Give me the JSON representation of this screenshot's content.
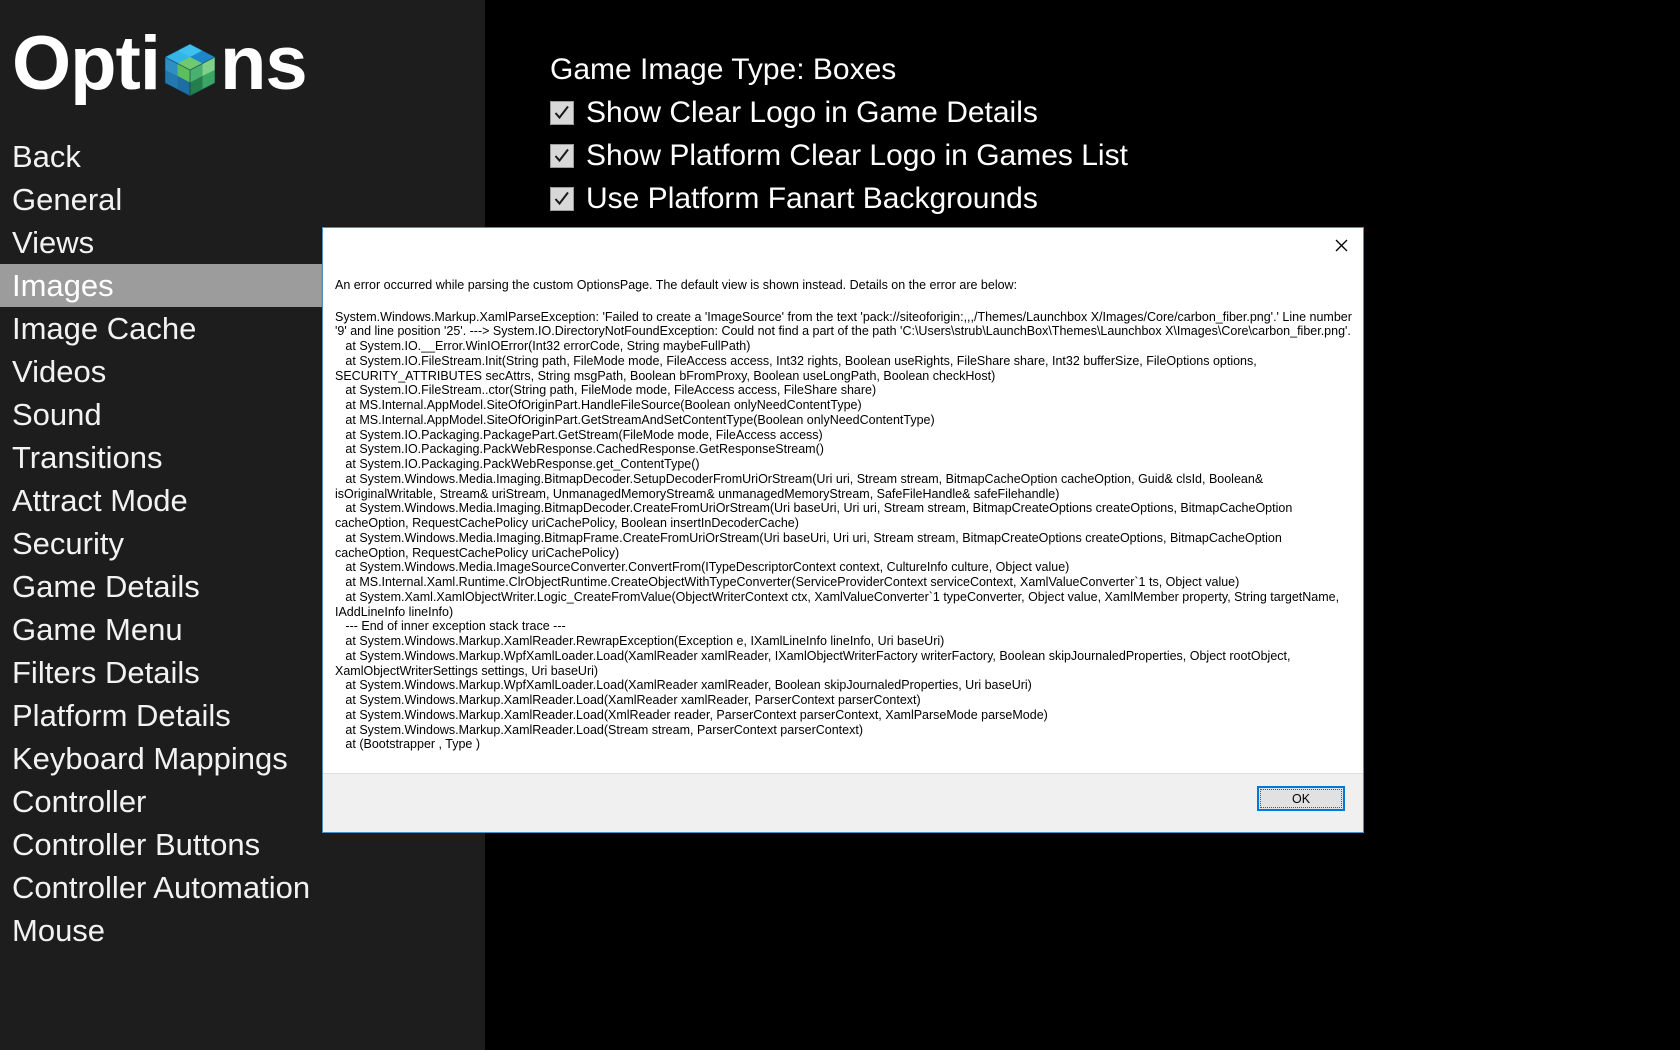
{
  "app": {
    "title_prefix": "Opti",
    "title_suffix": "ns",
    "logo_icon": "cube-icon"
  },
  "sidebar": {
    "items": [
      {
        "label": "Back",
        "selected": false
      },
      {
        "label": "General",
        "selected": false
      },
      {
        "label": "Views",
        "selected": false
      },
      {
        "label": "Images",
        "selected": true
      },
      {
        "label": "Image Cache",
        "selected": false
      },
      {
        "label": "Videos",
        "selected": false
      },
      {
        "label": "Sound",
        "selected": false
      },
      {
        "label": "Transitions",
        "selected": false
      },
      {
        "label": "Attract Mode",
        "selected": false
      },
      {
        "label": "Security",
        "selected": false
      },
      {
        "label": "Game Details",
        "selected": false
      },
      {
        "label": "Game Menu",
        "selected": false
      },
      {
        "label": "Filters Details",
        "selected": false
      },
      {
        "label": "Platform Details",
        "selected": false
      },
      {
        "label": "Keyboard Mappings",
        "selected": false
      },
      {
        "label": "Controller",
        "selected": false
      },
      {
        "label": "Controller Buttons",
        "selected": false
      },
      {
        "label": "Controller Automation",
        "selected": false
      },
      {
        "label": "Mouse",
        "selected": false
      }
    ],
    "selected_bg": "#9c9c9c",
    "panel_bg": "#1d1d1d"
  },
  "main": {
    "rows": [
      {
        "type": "text",
        "label": "Game Image Type: Boxes",
        "checked": null
      },
      {
        "type": "checkbox",
        "label": "Show Clear Logo in Game Details",
        "checked": true
      },
      {
        "type": "checkbox",
        "label": "Show Platform Clear Logo in Games List",
        "checked": true
      },
      {
        "type": "checkbox",
        "label": "Use Platform Fanart Backgrounds",
        "checked": true
      }
    ]
  },
  "dialog": {
    "close_icon": "close-icon",
    "intro": "An error occurred while parsing the custom OptionsPage. The default view is shown instead. Details on the error are below:",
    "stack_trace": "System.Windows.Markup.XamlParseException: 'Failed to create a 'ImageSource' from the text 'pack://siteoforigin:,,,/Themes/Launchbox X/Images/Core/carbon_fiber.png'.' Line number '9' and line position '25'. ---> System.IO.DirectoryNotFoundException: Could not find a part of the path 'C:\\Users\\strub\\LaunchBox\\Themes\\Launchbox X\\Images\\Core\\carbon_fiber.png'.\n   at System.IO.__Error.WinIOError(Int32 errorCode, String maybeFullPath)\n   at System.IO.FileStream.Init(String path, FileMode mode, FileAccess access, Int32 rights, Boolean useRights, FileShare share, Int32 bufferSize, FileOptions options, SECURITY_ATTRIBUTES secAttrs, String msgPath, Boolean bFromProxy, Boolean useLongPath, Boolean checkHost)\n   at System.IO.FileStream..ctor(String path, FileMode mode, FileAccess access, FileShare share)\n   at MS.Internal.AppModel.SiteOfOriginPart.HandleFileSource(Boolean onlyNeedContentType)\n   at MS.Internal.AppModel.SiteOfOriginPart.GetStreamAndSetContentType(Boolean onlyNeedContentType)\n   at System.IO.Packaging.PackagePart.GetStream(FileMode mode, FileAccess access)\n   at System.IO.Packaging.PackWebResponse.CachedResponse.GetResponseStream()\n   at System.IO.Packaging.PackWebResponse.get_ContentType()\n   at System.Windows.Media.Imaging.BitmapDecoder.SetupDecoderFromUriOrStream(Uri uri, Stream stream, BitmapCacheOption cacheOption, Guid& clsId, Boolean& isOriginalWritable, Stream& uriStream, UnmanagedMemoryStream& unmanagedMemoryStream, SafeFileHandle& safeFilehandle)\n   at System.Windows.Media.Imaging.BitmapDecoder.CreateFromUriOrStream(Uri baseUri, Uri uri, Stream stream, BitmapCreateOptions createOptions, BitmapCacheOption cacheOption, RequestCachePolicy uriCachePolicy, Boolean insertInDecoderCache)\n   at System.Windows.Media.Imaging.BitmapFrame.CreateFromUriOrStream(Uri baseUri, Uri uri, Stream stream, BitmapCreateOptions createOptions, BitmapCacheOption cacheOption, RequestCachePolicy uriCachePolicy)\n   at System.Windows.Media.ImageSourceConverter.ConvertFrom(ITypeDescriptorContext context, CultureInfo culture, Object value)\n   at MS.Internal.Xaml.Runtime.ClrObjectRuntime.CreateObjectWithTypeConverter(ServiceProviderContext serviceContext, XamlValueConverter`1 ts, Object value)\n   at System.Xaml.XamlObjectWriter.Logic_CreateFromValue(ObjectWriterContext ctx, XamlValueConverter`1 typeConverter, Object value, XamlMember property, String targetName, IAddLineInfo lineInfo)\n   --- End of inner exception stack trace ---\n   at System.Windows.Markup.XamlReader.RewrapException(Exception e, IXamlLineInfo lineInfo, Uri baseUri)\n   at System.Windows.Markup.WpfXamlLoader.Load(XamlReader xamlReader, IXamlObjectWriterFactory writerFactory, Boolean skipJournaledProperties, Object rootObject, XamlObjectWriterSettings settings, Uri baseUri)\n   at System.Windows.Markup.WpfXamlLoader.Load(XamlReader xamlReader, Boolean skipJournaledProperties, Uri baseUri)\n   at System.Windows.Markup.XamlReader.Load(XamlReader xamlReader, ParserContext parserContext)\n   at System.Windows.Markup.XamlReader.Load(XmlReader reader, ParserContext parserContext, XamlParseMode parseMode)\n   at System.Windows.Markup.XamlReader.Load(Stream stream, ParserContext parserContext)\n   at (Bootstrapper , Type )",
    "ok_label": "OK",
    "accent_color": "#0078d7",
    "border_color": "#4a90c4"
  }
}
